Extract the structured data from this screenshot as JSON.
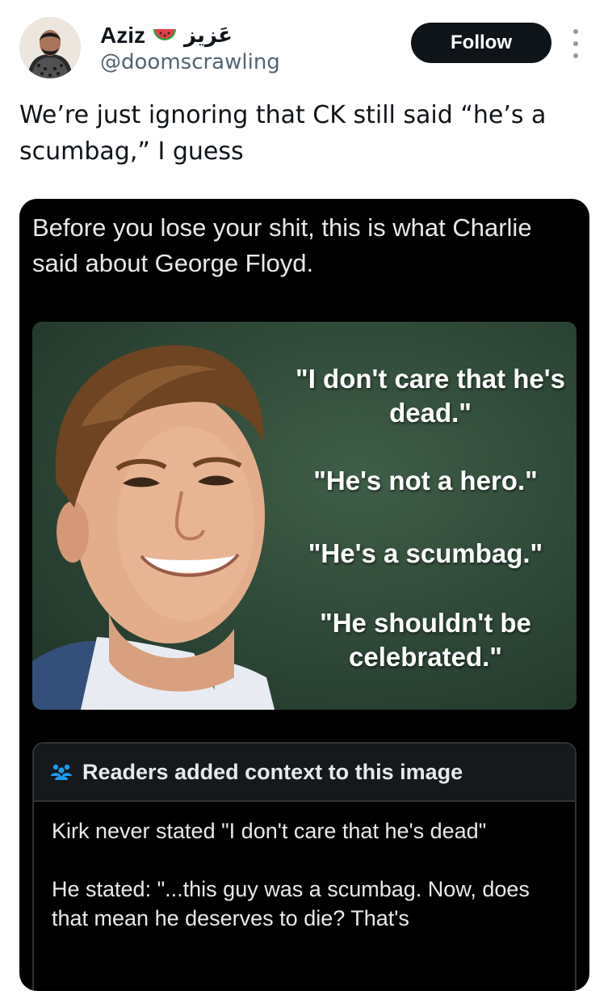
{
  "author": {
    "name": "Aziz",
    "arabic_name": "عَزيز",
    "badge_icon": "watermelon-icon",
    "handle": "@doomscrawling"
  },
  "actions": {
    "follow_label": "Follow",
    "more_icon": "more-vertical-icon"
  },
  "tweet": {
    "text": "We’re just ignoring that CK still said “he’s a scumbag,” I guess"
  },
  "quoted_media": {
    "caption": "Before you lose your shit, this is what Charlie said about George Floyd.",
    "image_quotes": [
      "\"I don't care that he's dead.\"",
      "\"He's not a hero.\"",
      "\"He's a scumbag.\"",
      "\"He shouldn't be celebrated.\""
    ]
  },
  "community_note": {
    "icon": "people-icon",
    "title": "Readers added context to this image",
    "paragraphs": [
      "Kirk never stated \"I don't care that he's dead\"",
      "He stated: \"...this guy was a scumbag. Now, does that mean he deserves to die? That's"
    ]
  },
  "colors": {
    "follow_bg": "#0f1419",
    "handle": "#536471",
    "note_icon": "#1d9bf0",
    "media_bg": "#000000"
  }
}
